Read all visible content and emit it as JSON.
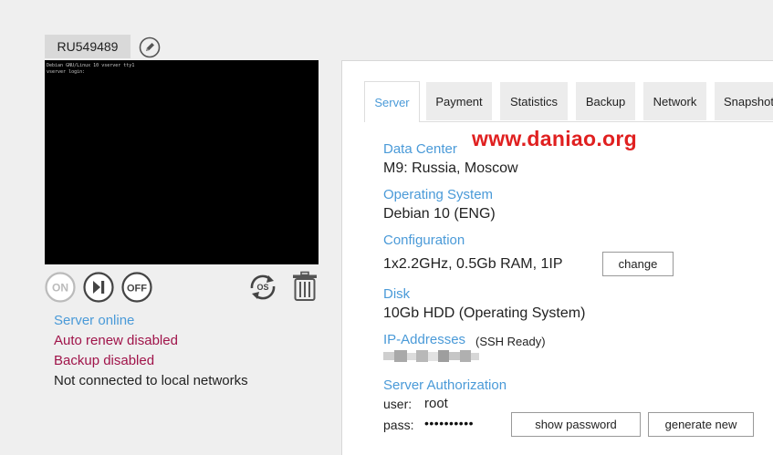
{
  "server": {
    "id": "RU549489",
    "console_lines": [
      "Debian GNU/Linux 10 vserver tty1",
      "vserver login:"
    ],
    "controls": {
      "on_label": "ON",
      "off_label": "OFF",
      "os_label": "OS"
    },
    "status": {
      "online": "Server online",
      "auto_renew": "Auto renew disabled",
      "backup": "Backup disabled",
      "networks": "Not connected to local networks"
    }
  },
  "tabs": [
    "Server",
    "Payment",
    "Statistics",
    "Backup",
    "Network",
    "Snapshot"
  ],
  "active_tab": "Server",
  "watermark": "www.daniao.org",
  "details": {
    "datacenter_label": "Data Center",
    "datacenter_value": "M9: Russia, Moscow",
    "os_label": "Operating System",
    "os_value": "Debian 10 (ENG)",
    "config_label": "Configuration",
    "config_value": "1x2.2GHz, 0.5Gb RAM, 1IP",
    "change_label": "change",
    "disk_label": "Disk",
    "disk_value": "10Gb HDD (Operating System)",
    "ip_label": "IP-Addresses",
    "ip_note": "(SSH Ready)",
    "auth_label": "Server Authorization",
    "user_label": "user:",
    "user_value": "root",
    "pass_label": "pass:",
    "pass_value": "••••••••••",
    "show_password_label": "show password",
    "generate_label": "generate new"
  },
  "colors": {
    "accent": "#4a9ad8",
    "warning": "#a0144a",
    "watermark": "#e02020"
  }
}
